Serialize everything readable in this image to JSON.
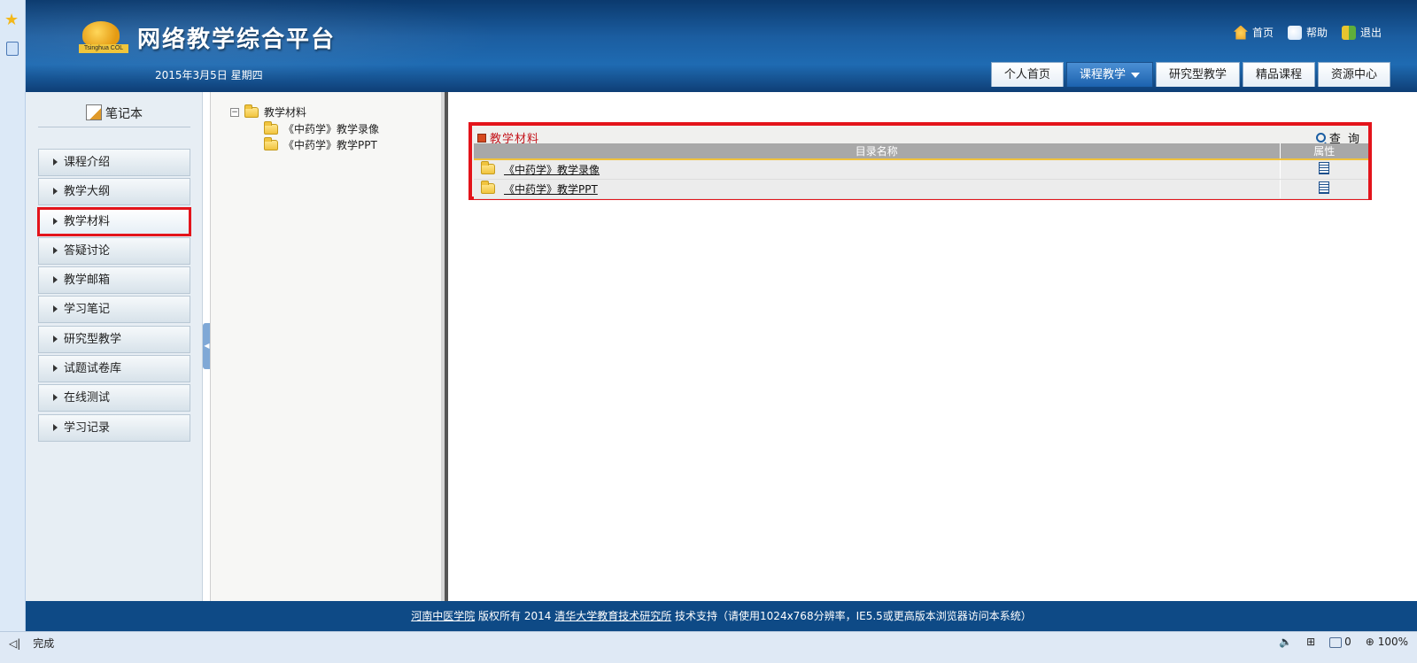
{
  "header": {
    "logo_text": "Tsinghua COL",
    "site_title": "网络教学综合平台",
    "date": "2015年3月5日 星期四",
    "top_links": [
      {
        "label": "首页",
        "icon": "home-icon"
      },
      {
        "label": "帮助",
        "icon": "help-icon"
      },
      {
        "label": "退出",
        "icon": "exit-icon"
      }
    ],
    "nav_tabs": [
      {
        "label": "个人首页",
        "active": false
      },
      {
        "label": "课程教学",
        "active": true
      },
      {
        "label": "研究型教学",
        "active": false
      },
      {
        "label": "精品课程",
        "active": false
      },
      {
        "label": "资源中心",
        "active": false
      }
    ]
  },
  "sidebar": {
    "notebook_label": "笔记本",
    "items": [
      {
        "label": "课程介绍"
      },
      {
        "label": "教学大纲"
      },
      {
        "label": "教学材料",
        "selected": true
      },
      {
        "label": "答疑讨论"
      },
      {
        "label": "教学邮箱"
      },
      {
        "label": "学习笔记"
      },
      {
        "label": "研究型教学"
      },
      {
        "label": "试题试卷库"
      },
      {
        "label": "在线测试"
      },
      {
        "label": "学习记录"
      }
    ]
  },
  "tree": {
    "root": {
      "label": "教学材料",
      "toggle": "−"
    },
    "children": [
      {
        "label": "《中药学》教学录像"
      },
      {
        "label": "《中药学》教学PPT"
      }
    ]
  },
  "main": {
    "section_title": "教学材料",
    "query_label": "查 询",
    "columns": [
      "目录名称",
      "属性"
    ],
    "rows": [
      {
        "name": "《中药学》教学录像"
      },
      {
        "name": "《中药学》教学PPT"
      }
    ]
  },
  "footer": {
    "org": "河南中医学院",
    "copyright": " 版权所有 2014 ",
    "support_org": "清华大学教育技术研究所",
    "support_text": " 技术支持（请使用1024x768分辨率，IE5.5或更高版本浏览器访问本系统）"
  },
  "statusbar": {
    "status": "完成",
    "blocked_count": "0",
    "zoom": "100%"
  },
  "colors": {
    "header_blue": "#1f6bb2",
    "highlight_red": "#e3141b",
    "footer_blue": "#0e4a86"
  }
}
